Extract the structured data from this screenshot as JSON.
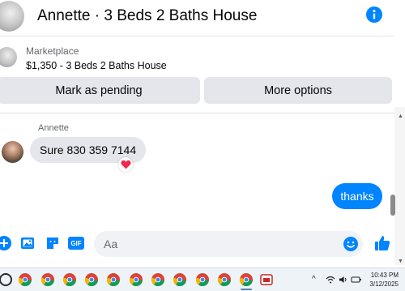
{
  "header": {
    "title": "Annette · 3 Beds 2 Baths House",
    "info_icon": "info-icon"
  },
  "marketplace": {
    "label": "Marketplace",
    "listing": "$1,350 - 3 Beds 2 Baths House",
    "mark_pending_label": "Mark as pending",
    "more_options_label": "More options"
  },
  "messages": {
    "sender": "Annette",
    "incoming_text": "Sure 830 359 7144",
    "reaction": "heart",
    "outgoing_text": "thanks"
  },
  "composer": {
    "placeholder": "Aa",
    "icons": [
      "plus-icon",
      "photo-icon",
      "sticker-icon",
      "gif-icon",
      "emoji-icon",
      "like-icon"
    ],
    "gif_label": "GIF"
  },
  "taskbar": {
    "time": "10:43 PM",
    "date": "3/12/2025"
  },
  "colors": {
    "accent": "#0084ff",
    "bubble_gray": "#e4e6eb",
    "reaction_red": "#f02849"
  }
}
